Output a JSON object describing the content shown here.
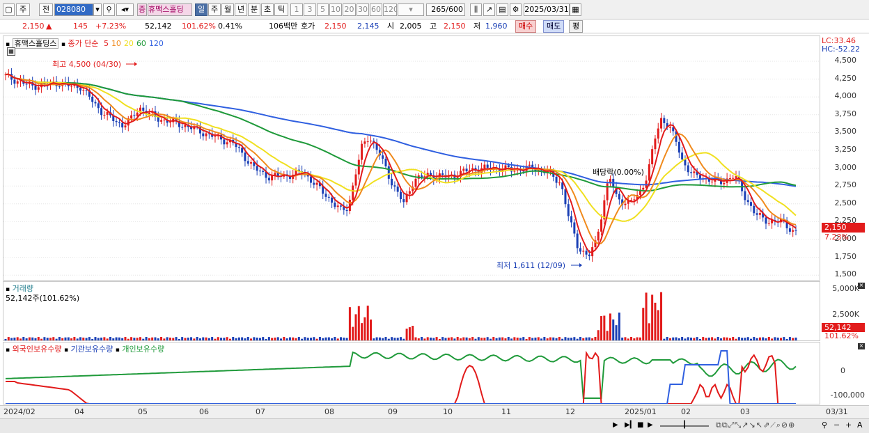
{
  "toolbar": {
    "mode1": "주",
    "mode2": "전",
    "code": "028080",
    "tag": "증",
    "name": "휴맥스홀딩",
    "periods": [
      "일",
      "주",
      "월",
      "년",
      "분",
      "초",
      "틱"
    ],
    "selected_period": "일",
    "intervals": [
      "1",
      "3",
      "5",
      "10",
      "20",
      "30",
      "60",
      "120"
    ],
    "count": "265",
    "count_max": "/600",
    "date": "2025/03/31"
  },
  "info": {
    "price": "2,150",
    "arrow": "▲",
    "change": "145",
    "change_pct": "+7.23%",
    "volume": "52,142",
    "vol_ratio": "101.62%",
    "turnover": "0.41%",
    "amount": "106백만",
    "quote_label": "호가",
    "ask": "2,150",
    "bid": "2,145",
    "open_label": "시",
    "open": "2,005",
    "high_label": "고",
    "high": "2,150",
    "low_label": "저",
    "low": "1,960",
    "buy": "매수",
    "sell": "매도",
    "eval": "평"
  },
  "price_pane": {
    "legend_name": "휴맥스홀딩스",
    "legend_type": "종가 단순",
    "ma": [
      {
        "label": "5",
        "color": "#e21b1b"
      },
      {
        "label": "10",
        "color": "#f08a1c"
      },
      {
        "label": "20",
        "color": "#f0e020"
      },
      {
        "label": "60",
        "color": "#1f9a3a"
      },
      {
        "label": "120",
        "color": "#2f5fe0"
      }
    ],
    "lc": "LC:33.46",
    "hc": "HC:-52.22",
    "ticks": [
      "4,500",
      "4,250",
      "4,000",
      "3,750",
      "3,500",
      "3,250",
      "3,000",
      "2,750",
      "2,500",
      "2,250",
      "2,000",
      "1,750",
      "1,500"
    ],
    "price_tag": "2,150",
    "pct_tag": "7.23%",
    "high_annot": "최고 4,500 (04/30)",
    "low_annot": "최저 1,611 (12/09)",
    "alloc_annot": "배당락(0.00%)"
  },
  "volume_pane": {
    "title": "거래량",
    "value": "52,142주(101.62%)",
    "ticks": [
      "5,000K",
      "2,500K"
    ],
    "tag": "52,142",
    "pct": "101.62%"
  },
  "holdings_pane": {
    "s1": "외국인보유수량",
    "s2": "기관보유수량",
    "s3": "개인보유수량",
    "ticks": [
      "0",
      "-100,000"
    ]
  },
  "xaxis": {
    "labels": [
      "2024/02",
      "04",
      "05",
      "06",
      "07",
      "08",
      "09",
      "10",
      "11",
      "12",
      "2025/01",
      "02",
      "03"
    ],
    "end": "03/31"
  },
  "colors": {
    "up": "#e21b1b",
    "down": "#1a3fb5",
    "ma5": "#e21b1b",
    "ma10": "#f08a1c",
    "ma20": "#f0e020",
    "ma60": "#1f9a3a",
    "ma120": "#2f5fe0"
  }
}
